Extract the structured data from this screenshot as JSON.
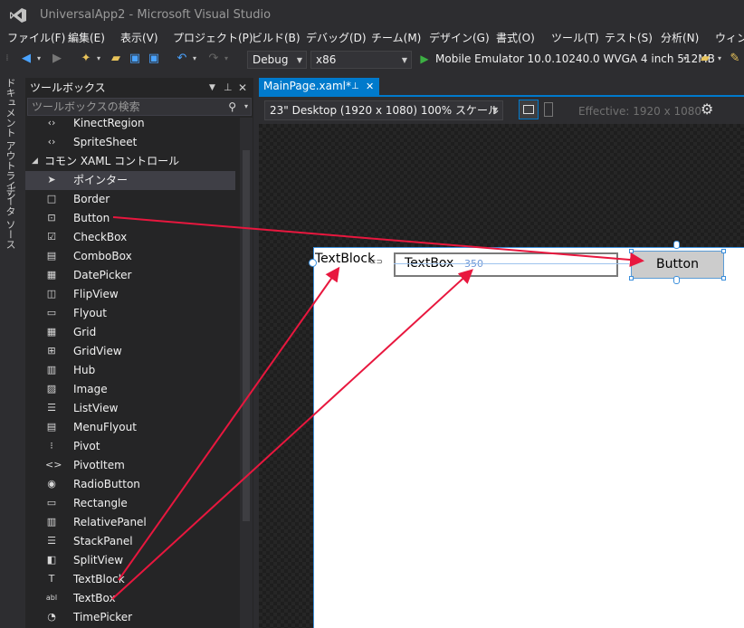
{
  "window": {
    "title": "UniversalApp2 - Microsoft Visual Studio"
  },
  "menu": [
    "ファイル(F)",
    "編集(E)",
    "表示(V)",
    "プロジェクト(P)",
    "ビルド(B)",
    "デバッグ(D)",
    "チーム(M)",
    "デザイン(G)",
    "書式(O)",
    "ツール(T)",
    "テスト(S)",
    "分析(N)",
    "ウィンド"
  ],
  "toolbar": {
    "config": "Debug",
    "platform": "x86",
    "run_target": "Mobile Emulator 10.0.10240.0 WVGA 4 inch 512MB"
  },
  "side_tabs": [
    "ドキュメント アウトライン",
    "データ ソース"
  ],
  "toolbox": {
    "title": "ツールボックス",
    "search_placeholder": "ツールボックスの検索",
    "group": "コモン XAML コントロール",
    "items_above": [
      {
        "label": "KinectRegion",
        "icon": "code-brackets-icon"
      },
      {
        "label": "SpriteSheet",
        "icon": "code-brackets-icon"
      }
    ],
    "items": [
      {
        "label": "ポインター",
        "icon": "pointer-icon",
        "glyph": "➤"
      },
      {
        "label": "Border",
        "icon": "border-icon",
        "glyph": "□"
      },
      {
        "label": "Button",
        "icon": "button-icon",
        "glyph": "⊡"
      },
      {
        "label": "CheckBox",
        "icon": "checkbox-icon",
        "glyph": "☑"
      },
      {
        "label": "ComboBox",
        "icon": "combobox-icon",
        "glyph": "▤"
      },
      {
        "label": "DatePicker",
        "icon": "datepicker-icon",
        "glyph": "▦"
      },
      {
        "label": "FlipView",
        "icon": "flipview-icon",
        "glyph": "◫"
      },
      {
        "label": "Flyout",
        "icon": "flyout-icon",
        "glyph": "▭"
      },
      {
        "label": "Grid",
        "icon": "grid-icon",
        "glyph": "▦"
      },
      {
        "label": "GridView",
        "icon": "gridview-icon",
        "glyph": "⊞"
      },
      {
        "label": "Hub",
        "icon": "hub-icon",
        "glyph": "▥"
      },
      {
        "label": "Image",
        "icon": "image-icon",
        "glyph": "▨"
      },
      {
        "label": "ListView",
        "icon": "listview-icon",
        "glyph": "☰"
      },
      {
        "label": "MenuFlyout",
        "icon": "menuflyout-icon",
        "glyph": "▤"
      },
      {
        "label": "Pivot",
        "icon": "pivot-icon",
        "glyph": "⁝"
      },
      {
        "label": "PivotItem",
        "icon": "pivotitem-icon",
        "glyph": "<>"
      },
      {
        "label": "RadioButton",
        "icon": "radiobutton-icon",
        "glyph": "◉"
      },
      {
        "label": "Rectangle",
        "icon": "rectangle-icon",
        "glyph": "▭"
      },
      {
        "label": "RelativePanel",
        "icon": "relativepanel-icon",
        "glyph": "▥"
      },
      {
        "label": "StackPanel",
        "icon": "stackpanel-icon",
        "glyph": "☰"
      },
      {
        "label": "SplitView",
        "icon": "splitview-icon",
        "glyph": "◧"
      },
      {
        "label": "TextBlock",
        "icon": "textblock-icon",
        "glyph": "T"
      },
      {
        "label": "TextBox",
        "icon": "textbox-icon",
        "glyph": "abl"
      },
      {
        "label": "TimePicker",
        "icon": "timepicker-icon",
        "glyph": "◔"
      }
    ]
  },
  "document": {
    "tab": "MainPage.xaml*",
    "zoom": "23\" Desktop (1920 x 1080) 100% スケール",
    "effective": "Effective: 1920 x 1080"
  },
  "design": {
    "textblock": "TextBlock",
    "textbox": "TextBox",
    "textbox_width": "350",
    "button": "Button"
  },
  "colors": {
    "accent": "#007acc",
    "annotation": "#e8173e"
  }
}
